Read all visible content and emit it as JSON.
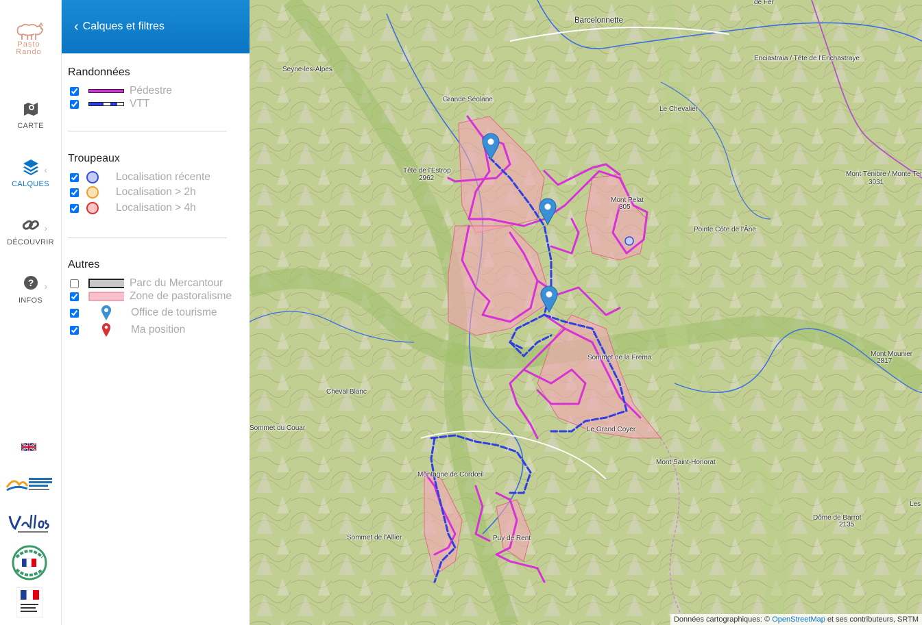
{
  "logo": {
    "line1": "Pasto",
    "line2": "Rando"
  },
  "nav": [
    {
      "label": "CARTE",
      "icon": "map-icon",
      "active": false
    },
    {
      "label": "CALQUES",
      "icon": "layers-icon",
      "active": true
    },
    {
      "label": "DÉCOUVRIR",
      "icon": "link-icon",
      "active": false
    },
    {
      "label": "INFOS",
      "icon": "help-icon",
      "active": false
    }
  ],
  "panel": {
    "back_label": "Calques et filtres",
    "sections": {
      "hikes": {
        "title": "Randonnées",
        "items": [
          {
            "label": "Pédestre",
            "checked": true,
            "color": "#d633d6"
          },
          {
            "label": "VTT",
            "checked": true,
            "color": "#2f3fe0"
          }
        ]
      },
      "herds": {
        "title": "Troupeaux",
        "items": [
          {
            "label": "Localisation récente",
            "checked": true,
            "color": "#3050e0"
          },
          {
            "label": "Localisation > 2h",
            "checked": true,
            "color": "#f0a030"
          },
          {
            "label": "Localisation > 4h",
            "checked": true,
            "color": "#e03030"
          }
        ]
      },
      "others": {
        "title": "Autres",
        "items": [
          {
            "label": "Parc du Mercantour",
            "checked": false
          },
          {
            "label": "Zone de pastoralisme",
            "checked": true
          },
          {
            "label": "Office de tourisme",
            "checked": true
          },
          {
            "label": "Ma position",
            "checked": true
          }
        ]
      }
    }
  },
  "map": {
    "places": [
      {
        "name": "Barcelonnette"
      },
      {
        "name": "Seyne-les-Alpes"
      },
      {
        "name": "Grande Séolane"
      },
      {
        "name": "Tête de l'Estrop"
      },
      {
        "name": "2962"
      },
      {
        "name": "Le Chevalier"
      },
      {
        "name": "Enciastraia / Tête de l'Enchastraye"
      },
      {
        "name": "Mont Ténibre / Monte Ten"
      },
      {
        "name": "3031"
      },
      {
        "name": "Mont Pelat"
      },
      {
        "name": "305"
      },
      {
        "name": "Pointe Côte de l'Âne"
      },
      {
        "name": "Sommet de la Frema"
      },
      {
        "name": "Mont Mounier"
      },
      {
        "name": "2817"
      },
      {
        "name": "Cheval Blanc"
      },
      {
        "name": "Sommet du Couar"
      },
      {
        "name": "Le Grand Coyer"
      },
      {
        "name": "Mont Saint-Honorat"
      },
      {
        "name": "Montagne de Cordœil"
      },
      {
        "name": "Dôme de Barrot"
      },
      {
        "name": "2135"
      },
      {
        "name": "Sommet de l'Allier"
      },
      {
        "name": "Puy de Rent"
      },
      {
        "name": "Les"
      },
      {
        "name": "de Fer"
      }
    ],
    "attribution_prefix": "Données cartographiques: ©",
    "attribution_link": "OpenStreetMap",
    "attribution_suffix": "et ses contributeurs, SRTM"
  }
}
